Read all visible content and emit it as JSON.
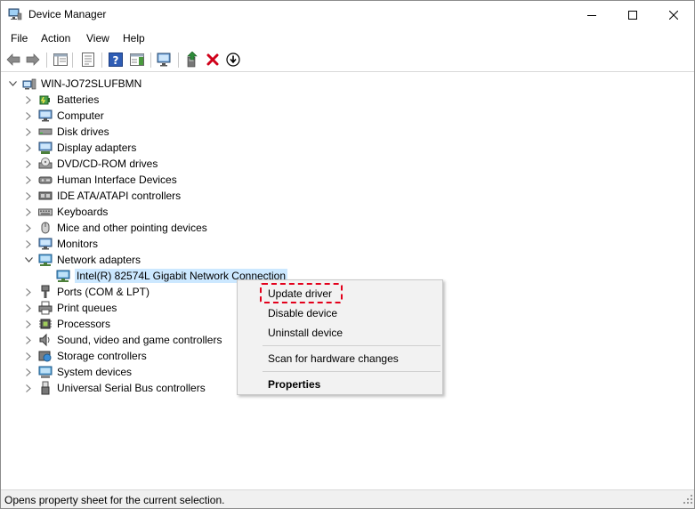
{
  "window": {
    "title": "Device Manager"
  },
  "menu": [
    "File",
    "Action",
    "View",
    "Help"
  ],
  "toolbar": {
    "icons": [
      "back-arrow-icon",
      "forward-arrow-icon",
      "show-hide-console-tree-icon",
      "properties-icon",
      "help-icon",
      "action-pane-icon",
      "scan-hardware-icon",
      "update-driver-icon",
      "uninstall-device-icon",
      "download-icon"
    ],
    "colors": {
      "uninstall": "#d0021b",
      "update": "#2e8b3a"
    }
  },
  "tree": {
    "root": "WIN-JO72SLUFBMN",
    "categories": [
      {
        "label": "Batteries",
        "icon": "battery-icon",
        "expanded": false
      },
      {
        "label": "Computer",
        "icon": "computer-icon",
        "expanded": false
      },
      {
        "label": "Disk drives",
        "icon": "disk-drive-icon",
        "expanded": false
      },
      {
        "label": "Display adapters",
        "icon": "display-adapter-icon",
        "expanded": false
      },
      {
        "label": "DVD/CD-ROM drives",
        "icon": "dvd-drive-icon",
        "expanded": false
      },
      {
        "label": "Human Interface Devices",
        "icon": "hid-icon",
        "expanded": false
      },
      {
        "label": "IDE ATA/ATAPI controllers",
        "icon": "ide-controller-icon",
        "expanded": false
      },
      {
        "label": "Keyboards",
        "icon": "keyboard-icon",
        "expanded": false
      },
      {
        "label": "Mice and other pointing devices",
        "icon": "mouse-icon",
        "expanded": false
      },
      {
        "label": "Monitors",
        "icon": "monitor-icon",
        "expanded": false
      },
      {
        "label": "Network adapters",
        "icon": "network-adapter-icon",
        "expanded": true
      },
      {
        "label": "Ports (COM & LPT)",
        "icon": "port-icon",
        "expanded": false
      },
      {
        "label": "Print queues",
        "icon": "printer-icon",
        "expanded": false
      },
      {
        "label": "Processors",
        "icon": "processor-icon",
        "expanded": false
      },
      {
        "label": "Sound, video and game controllers",
        "icon": "speaker-icon",
        "expanded": false
      },
      {
        "label": "Storage controllers",
        "icon": "storage-controller-icon",
        "expanded": false
      },
      {
        "label": "System devices",
        "icon": "system-device-icon",
        "expanded": false
      },
      {
        "label": "Universal Serial Bus controllers",
        "icon": "usb-icon",
        "expanded": false
      }
    ],
    "selected_device": "Intel(R) 82574L Gigabit Network Connection"
  },
  "context_menu": {
    "items": [
      "Update driver",
      "Disable device",
      "Uninstall device",
      "Scan for hardware changes",
      "Properties"
    ],
    "highlight_color": "#e3001b"
  },
  "statusbar": {
    "text": "Opens property sheet for the current selection."
  }
}
